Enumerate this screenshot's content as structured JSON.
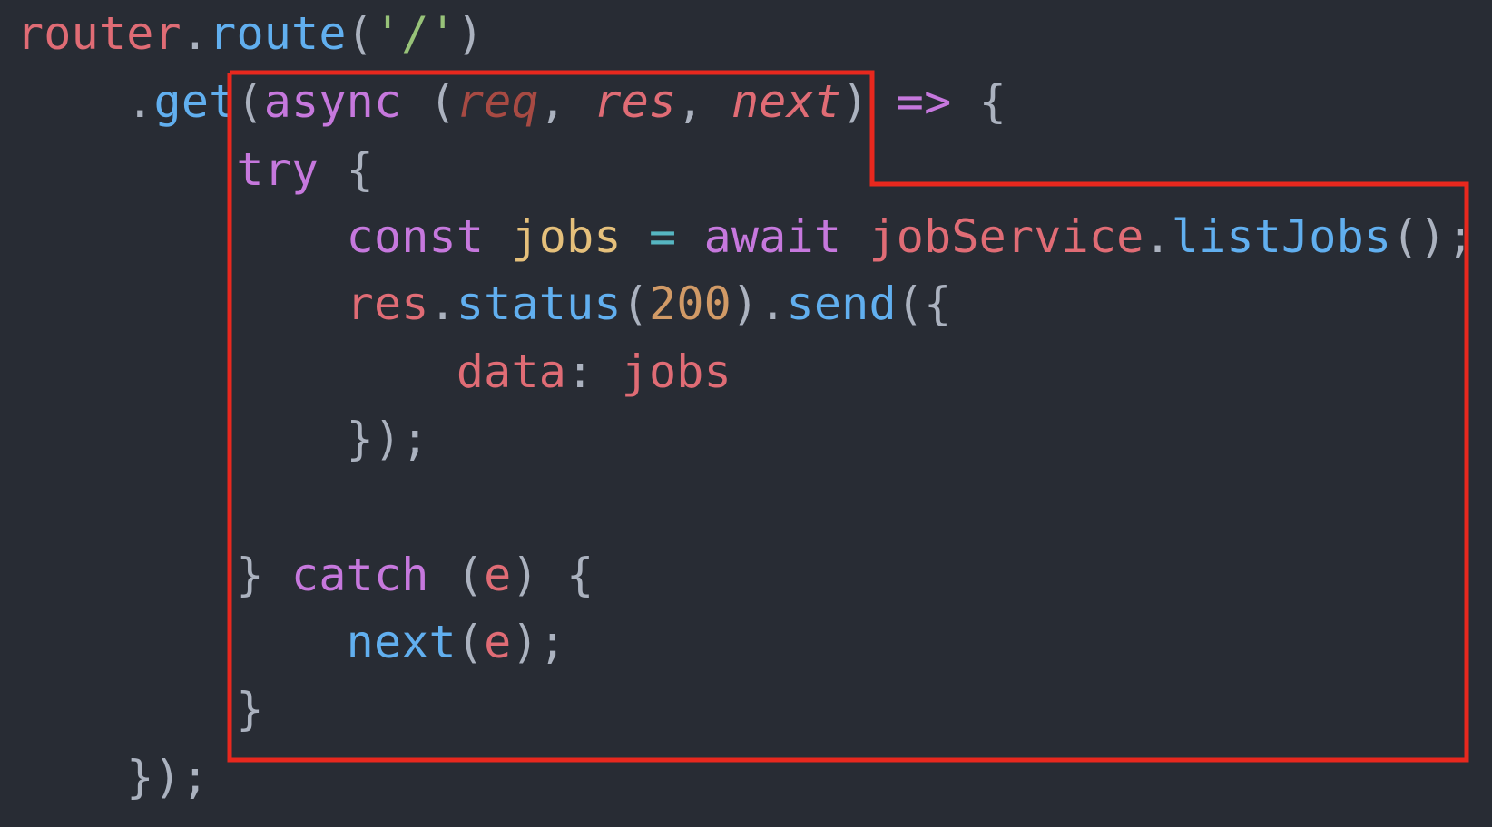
{
  "code": {
    "lines": [
      {
        "tokens": [
          {
            "text": "router",
            "cls": "tok-red"
          },
          {
            "text": ".",
            "cls": "tok-plain"
          },
          {
            "text": "route",
            "cls": "tok-blue"
          },
          {
            "text": "(",
            "cls": "tok-plain"
          },
          {
            "text": "'/'",
            "cls": "tok-green"
          },
          {
            "text": ")",
            "cls": "tok-plain"
          }
        ]
      },
      {
        "tokens": [
          {
            "text": "    ",
            "cls": "tok-plain"
          },
          {
            "text": ".",
            "cls": "tok-plain"
          },
          {
            "text": "get",
            "cls": "tok-blue"
          },
          {
            "text": "(",
            "cls": "tok-plain"
          },
          {
            "text": "async",
            "cls": "tok-purple"
          },
          {
            "text": " (",
            "cls": "tok-plain"
          },
          {
            "text": "req",
            "cls": "tok-param-dim"
          },
          {
            "text": ", ",
            "cls": "tok-plain"
          },
          {
            "text": "res",
            "cls": "tok-param"
          },
          {
            "text": ", ",
            "cls": "tok-plain"
          },
          {
            "text": "next",
            "cls": "tok-param"
          },
          {
            "text": ") ",
            "cls": "tok-plain"
          },
          {
            "text": "=>",
            "cls": "tok-purple"
          },
          {
            "text": " {",
            "cls": "tok-plain"
          }
        ]
      },
      {
        "tokens": [
          {
            "text": "        ",
            "cls": "tok-plain"
          },
          {
            "text": "try",
            "cls": "tok-purple"
          },
          {
            "text": " {",
            "cls": "tok-plain"
          }
        ]
      },
      {
        "tokens": [
          {
            "text": "            ",
            "cls": "tok-plain"
          },
          {
            "text": "const",
            "cls": "tok-purple"
          },
          {
            "text": " ",
            "cls": "tok-plain"
          },
          {
            "text": "jobs",
            "cls": "tok-yellow"
          },
          {
            "text": " ",
            "cls": "tok-plain"
          },
          {
            "text": "=",
            "cls": "tok-cyan"
          },
          {
            "text": " ",
            "cls": "tok-plain"
          },
          {
            "text": "await",
            "cls": "tok-purple"
          },
          {
            "text": " ",
            "cls": "tok-plain"
          },
          {
            "text": "jobService",
            "cls": "tok-red"
          },
          {
            "text": ".",
            "cls": "tok-plain"
          },
          {
            "text": "listJobs",
            "cls": "tok-blue"
          },
          {
            "text": "();",
            "cls": "tok-plain"
          }
        ]
      },
      {
        "tokens": [
          {
            "text": "            ",
            "cls": "tok-plain"
          },
          {
            "text": "res",
            "cls": "tok-red"
          },
          {
            "text": ".",
            "cls": "tok-plain"
          },
          {
            "text": "status",
            "cls": "tok-blue"
          },
          {
            "text": "(",
            "cls": "tok-plain"
          },
          {
            "text": "200",
            "cls": "tok-orange"
          },
          {
            "text": ").",
            "cls": "tok-plain"
          },
          {
            "text": "send",
            "cls": "tok-blue"
          },
          {
            "text": "({",
            "cls": "tok-plain"
          }
        ]
      },
      {
        "tokens": [
          {
            "text": "                ",
            "cls": "tok-plain"
          },
          {
            "text": "data",
            "cls": "tok-red"
          },
          {
            "text": ": ",
            "cls": "tok-plain"
          },
          {
            "text": "jobs",
            "cls": "tok-red"
          }
        ]
      },
      {
        "tokens": [
          {
            "text": "            ",
            "cls": "tok-plain"
          },
          {
            "text": "});",
            "cls": "tok-plain"
          }
        ]
      },
      {
        "tokens": [
          {
            "text": "",
            "cls": "tok-plain"
          }
        ]
      },
      {
        "tokens": [
          {
            "text": "        ",
            "cls": "tok-plain"
          },
          {
            "text": "}",
            "cls": "tok-plain"
          },
          {
            "text": " ",
            "cls": "tok-plain"
          },
          {
            "text": "catch",
            "cls": "tok-purple"
          },
          {
            "text": " (",
            "cls": "tok-plain"
          },
          {
            "text": "e",
            "cls": "tok-red"
          },
          {
            "text": ") {",
            "cls": "tok-plain"
          }
        ]
      },
      {
        "tokens": [
          {
            "text": "            ",
            "cls": "tok-plain"
          },
          {
            "text": "next",
            "cls": "tok-blue"
          },
          {
            "text": "(",
            "cls": "tok-plain"
          },
          {
            "text": "e",
            "cls": "tok-red"
          },
          {
            "text": ");",
            "cls": "tok-plain"
          }
        ]
      },
      {
        "tokens": [
          {
            "text": "        ",
            "cls": "tok-plain"
          },
          {
            "text": "}",
            "cls": "tok-plain"
          }
        ]
      },
      {
        "tokens": [
          {
            "text": "    ",
            "cls": "tok-plain"
          },
          {
            "text": "});",
            "cls": "tok-plain"
          }
        ]
      }
    ]
  },
  "colors": {
    "background": "#282c34",
    "highlight_outline": "#e8281e"
  }
}
